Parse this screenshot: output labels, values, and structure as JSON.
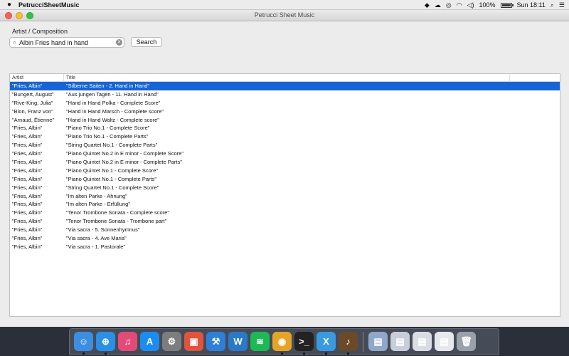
{
  "menubar": {
    "app_name": "PetrucciSheetMusic",
    "battery_percent": 100,
    "battery_label": "100%",
    "clock": "Sun 18:11"
  },
  "window": {
    "title": "Petrucci Sheet Music"
  },
  "search": {
    "label": "Artist / Composition",
    "value": "Albin Fries hand in hand",
    "button_label": "Search"
  },
  "table": {
    "columns": [
      "Artist",
      "Title"
    ],
    "selected_index": 0,
    "rows": [
      {
        "artist": "\"Fries, Albin\"",
        "title": "\"Silberne Saiten - 2. Hand in Hand\""
      },
      {
        "artist": "\"Bungert, August\"",
        "title": "\"Aus jungen Tagen - 11. Hand in Hand\""
      },
      {
        "artist": "\"Rive-King, Julia\"",
        "title": "\"Hand in Hand Polka - Complete Score\""
      },
      {
        "artist": "\"Blon, Franz von\"",
        "title": "\"Hand in Hand Marsch - Complete score\""
      },
      {
        "artist": "\"Arnaud, Étienne\"",
        "title": "\"Hand in Hand Waltz - Complete score\""
      },
      {
        "artist": "\"Fries, Albin\"",
        "title": "\"Piano Trio No.1 - Complete Score\""
      },
      {
        "artist": "\"Fries, Albin\"",
        "title": "\"Piano Trio No.1 - Complete Parts\""
      },
      {
        "artist": "\"Fries, Albin\"",
        "title": "\"String Quartet No.1 - Complete Parts\""
      },
      {
        "artist": "\"Fries, Albin\"",
        "title": "\"Piano Quintet No.2 in E minor - Complete Score\""
      },
      {
        "artist": "\"Fries, Albin\"",
        "title": "\"Piano Quintet No.2 in E minor - Complete Parts\""
      },
      {
        "artist": "\"Fries, Albin\"",
        "title": "\"Piano Quintet No.1 - Complete Score\""
      },
      {
        "artist": "\"Fries, Albin\"",
        "title": "\"Piano Quintet No.1 - Complete Parts\""
      },
      {
        "artist": "\"Fries, Albin\"",
        "title": "\"String Quartet No.1 - Complete Score\""
      },
      {
        "artist": "\"Fries, Albin\"",
        "title": "\"Im alten Parke - Ahnung\""
      },
      {
        "artist": "\"Fries, Albin\"",
        "title": "\"Im alten Parke - Erfüllung\""
      },
      {
        "artist": "\"Fries, Albin\"",
        "title": "\"Tenor Trombone Sonata - Complete score\""
      },
      {
        "artist": "\"Fries, Albin\"",
        "title": "\"Tenor Trombone Sonata - Trombone part\""
      },
      {
        "artist": "\"Fries, Albin\"",
        "title": "\"Via sacra - 5. Sonnenhymnus\""
      },
      {
        "artist": "\"Fries, Albin\"",
        "title": "\"Via sacra - 4. Ave Maria\""
      },
      {
        "artist": "\"Fries, Albin\"",
        "title": "\"Via sacra - 1. Pastorale\""
      }
    ]
  },
  "dock": {
    "items": [
      {
        "name": "finder-icon",
        "glyph": "☺",
        "color": "#3d8ee0",
        "running": true
      },
      {
        "name": "safari-icon",
        "glyph": "⊕",
        "color": "#2a8fe6",
        "running": true
      },
      {
        "name": "itunes-icon",
        "glyph": "♫",
        "color": "#e24b78",
        "running": false
      },
      {
        "name": "app-store-icon",
        "glyph": "A",
        "color": "#1d8cf0",
        "running": false
      },
      {
        "name": "system-preferences-icon",
        "glyph": "⚙",
        "color": "#7d7d7d",
        "running": false
      },
      {
        "name": "screen-sharing-icon",
        "glyph": "▣",
        "color": "#e0533d",
        "running": false
      },
      {
        "name": "xcode-icon",
        "glyph": "⚒",
        "color": "#2f7fd8",
        "running": false
      },
      {
        "name": "word-icon",
        "glyph": "W",
        "color": "#2b78c9",
        "running": false
      },
      {
        "name": "spotify-icon",
        "glyph": "≋",
        "color": "#1db954",
        "running": false
      },
      {
        "name": "chrome-icon",
        "glyph": "◉",
        "color": "#e4a526",
        "running": true
      },
      {
        "name": "terminal-icon",
        "glyph": ">_",
        "color": "#222222",
        "running": true
      },
      {
        "name": "xamarin-icon",
        "glyph": "X",
        "color": "#3a9ae0",
        "running": true
      },
      {
        "name": "petrucci-sheet-music-icon",
        "glyph": "♪",
        "color": "#6b4a2a",
        "running": true
      },
      {
        "name": "separator",
        "glyph": "",
        "color": "",
        "running": false
      },
      {
        "name": "minimized-window-1-icon",
        "glyph": "▤",
        "color": "#8fa7c9",
        "running": false
      },
      {
        "name": "minimized-window-2-icon",
        "glyph": "▤",
        "color": "#c7ced9",
        "running": false
      },
      {
        "name": "minimized-window-3-icon",
        "glyph": "▤",
        "color": "#d9dde3",
        "running": false
      },
      {
        "name": "minimized-window-4-icon",
        "glyph": "▤",
        "color": "#e6e8ec",
        "running": false
      },
      {
        "name": "trash-icon",
        "glyph": "🗑",
        "color": "#9aa1ab",
        "running": false
      }
    ]
  }
}
